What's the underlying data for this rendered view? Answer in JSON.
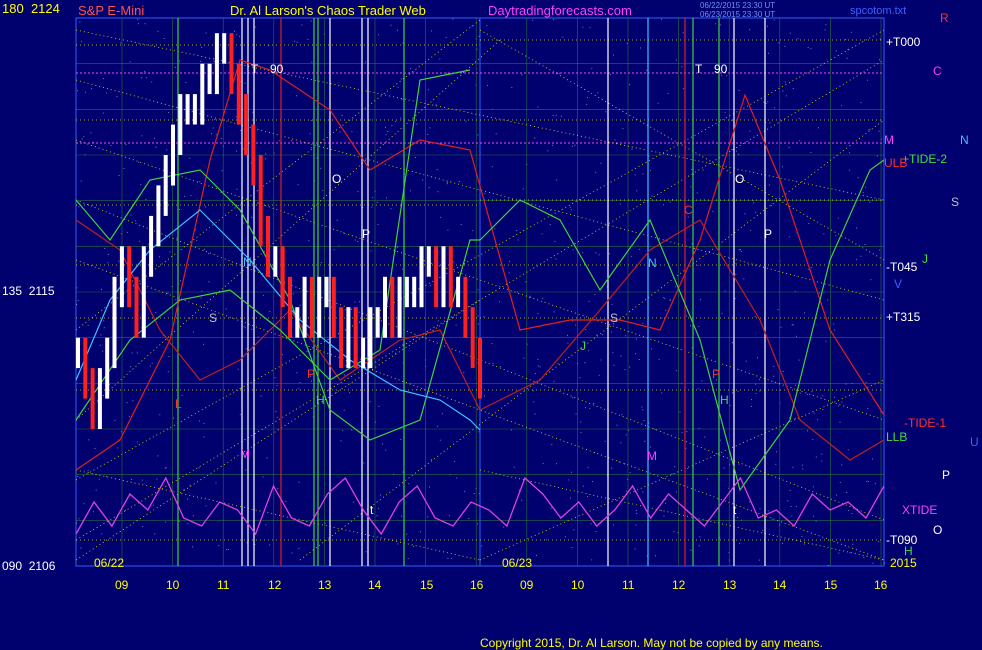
{
  "header": {
    "symbol": "S&P E-Mini",
    "title": "Dr. Al Larson's Chaos Trader Web",
    "site": "Daytradingforecasts.com",
    "stamp1": "06/22/2015 23:30 UT",
    "stamp2": "06/23/2015 23:30 UT",
    "site2": "spcotom.txt",
    "copyright": "Copyright 2015, Dr. Al Larson. May not be copied by any means."
  },
  "colors": {
    "background": "#00006e",
    "grid": "#2f8f2f",
    "price_up": "#ffffff",
    "price_down": "#ff2020",
    "fib_lines": "#e0e000",
    "tide": "#e040e0",
    "red_curve": "#e02020",
    "green_curve": "#40d040",
    "cyan_curve": "#40c0ff"
  },
  "chart_data": {
    "type": "line",
    "title": "S&P E-Mini",
    "y_axis_labels": [
      {
        "angle": "180",
        "price": "2124"
      },
      {
        "angle": "135",
        "price": "2115"
      },
      {
        "angle": "090",
        "price": "2106"
      }
    ],
    "ylim": [
      2106,
      2124
    ],
    "x_tick_labels": [
      "09",
      "10",
      "11",
      "12",
      "13",
      "14",
      "15",
      "16",
      "09",
      "10",
      "11",
      "12",
      "13",
      "14",
      "15",
      "16"
    ],
    "date_labels": [
      "06/22",
      "06/23",
      "2015"
    ],
    "right_labels": [
      "+T000",
      "M",
      "+TIDE-2",
      "ULB",
      "-T045",
      "+T315",
      "-TIDE-1",
      "LLB",
      "XTIDE",
      "-T090"
    ],
    "planet_labels": [
      "R",
      "C",
      "N",
      "S",
      "J",
      "V",
      "U",
      "P",
      "O",
      "H",
      "M"
    ],
    "vertical_markers": [
      "T",
      "90",
      "O",
      "P",
      "N",
      "S",
      "L",
      "M",
      "J",
      "H",
      "t",
      "P",
      "H",
      "C",
      "V"
    ],
    "series": [
      {
        "name": "S&P E-Mini",
        "values": [
          2113,
          2112,
          2111,
          2112,
          2113,
          2115,
          2116,
          2115,
          2114,
          2116,
          2117,
          2118,
          2119,
          2120,
          2121,
          2121,
          2121,
          2122,
          2122,
          2123,
          2123,
          2122,
          2121,
          2120,
          2119,
          2117,
          2116,
          2116,
          2115,
          2114,
          2114,
          2115,
          2114,
          2115,
          2115,
          2114,
          2113,
          2114,
          2113,
          2113,
          2114,
          2114,
          2115,
          2114,
          2115,
          2115,
          2115,
          2116,
          2116,
          2115,
          2116,
          2115,
          2115,
          2114,
          2113,
          2112
        ]
      },
      {
        "name": "TIDE",
        "values": [
          0.2,
          0.6,
          0.3,
          0.7,
          0.5,
          0.9,
          0.4,
          0.3,
          0.6,
          0.5,
          0.2,
          0.8,
          0.4,
          0.3,
          0.7,
          0.9,
          0.5,
          0.2,
          0.6,
          0.8,
          0.4,
          0.3,
          0.6,
          0.5,
          0.3,
          0.9,
          0.7,
          0.4,
          0.6,
          0.3,
          0.5,
          0.8,
          0.4,
          0.7,
          0.5,
          0.3,
          0.6,
          0.9,
          0.4,
          0.5,
          0.3,
          0.7,
          0.5,
          0.6,
          0.4,
          0.8
        ]
      }
    ]
  }
}
